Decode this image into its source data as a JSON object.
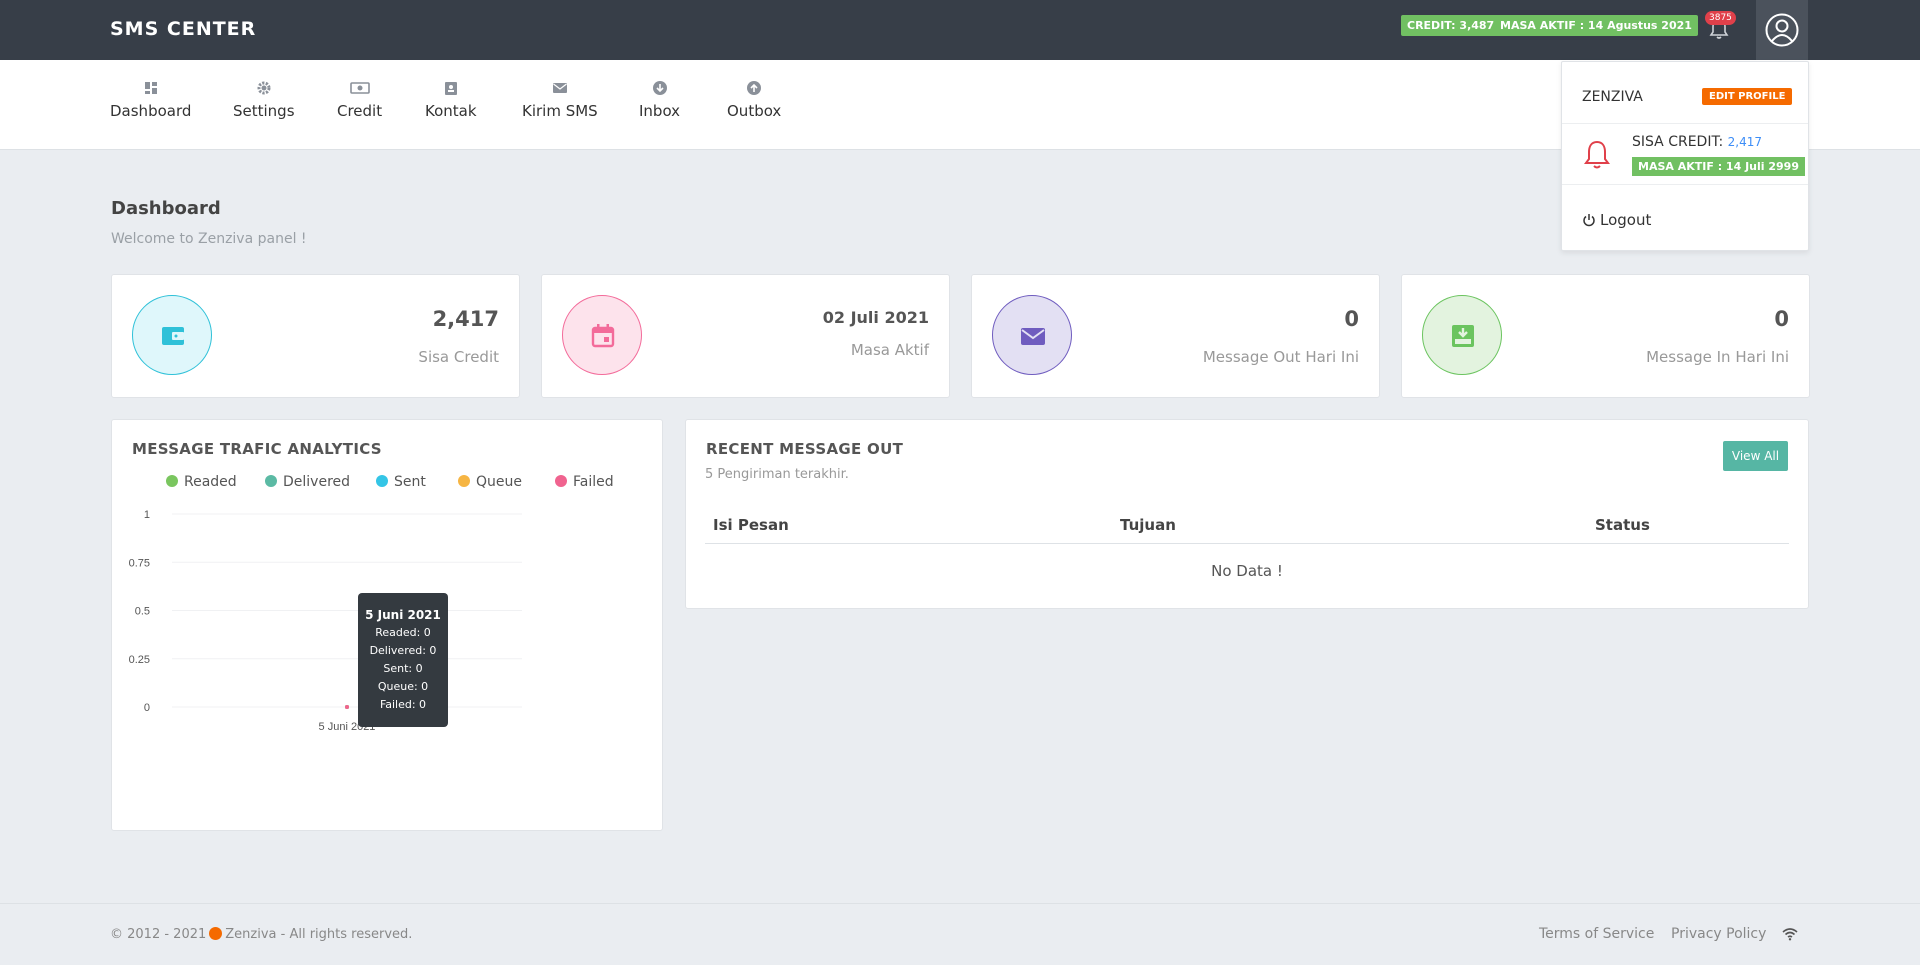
{
  "header": {
    "brand": "SMS CENTER",
    "credit_pill": "CREDIT: 3,487",
    "masa_pill": "MASA AKTIF : 14 Agustus 2021",
    "notif_count": "3875"
  },
  "nav": {
    "items": [
      {
        "label": "Dashboard",
        "icon": "dashboard-icon"
      },
      {
        "label": "Settings",
        "icon": "gear-icon"
      },
      {
        "label": "Credit",
        "icon": "money-icon"
      },
      {
        "label": "Kontak",
        "icon": "contact-icon"
      },
      {
        "label": "Kirim SMS",
        "icon": "envelope-icon"
      },
      {
        "label": "Inbox",
        "icon": "arrow-down-icon"
      },
      {
        "label": "Outbox",
        "icon": "arrow-up-icon"
      }
    ]
  },
  "page": {
    "title": "Dashboard",
    "subtitle": "Welcome to Zenziva panel !"
  },
  "stats": [
    {
      "value": "2,417",
      "label": "Sisa Credit",
      "color": "#2fc1d8",
      "icon": "wallet-icon"
    },
    {
      "value": "02 Juli 2021",
      "label": "Masa Aktif",
      "color": "#f36b9a",
      "icon": "calendar-icon"
    },
    {
      "value": "0",
      "label": "Message Out Hari Ini",
      "color": "#6f5cbf",
      "icon": "mail-icon"
    },
    {
      "value": "0",
      "label": "Message In Hari Ini",
      "color": "#6bc45f",
      "icon": "inbox-tray-icon"
    }
  ],
  "analytics": {
    "title": "MESSAGE TRAFIC ANALYTICS",
    "tooltip": {
      "title": "5 Juni 2021",
      "lines": [
        "Readed: 0",
        "Delivered: 0",
        "Sent: 0",
        "Queue: 0",
        "Failed: 0"
      ]
    }
  },
  "chart_data": {
    "type": "line",
    "x": [
      "5 Juni 2021"
    ],
    "series": [
      {
        "name": "Readed",
        "values": [
          0
        ],
        "color": "#7ac65f"
      },
      {
        "name": "Delivered",
        "values": [
          0
        ],
        "color": "#5bbaa4"
      },
      {
        "name": "Sent",
        "values": [
          0
        ],
        "color": "#34c5e6"
      },
      {
        "name": "Queue",
        "values": [
          0
        ],
        "color": "#f6b543"
      },
      {
        "name": "Failed",
        "values": [
          0
        ],
        "color": "#f0638f"
      }
    ],
    "y_ticks": [
      "1",
      "0.75",
      "0.5",
      "0.25",
      "0"
    ],
    "ylim": [
      0,
      1
    ],
    "grid": true,
    "legend": "top"
  },
  "recent": {
    "title": "RECENT MESSAGE OUT",
    "subtitle": "5 Pengiriman terakhir.",
    "view_all": "View All",
    "columns": [
      "Isi Pesan",
      "Tujuan",
      "Status"
    ],
    "empty": "No Data !"
  },
  "dropdown": {
    "name": "ZENZIVA",
    "edit": "EDIT PROFILE",
    "credit_label": "SISA CREDIT:",
    "credit_value": "2,417",
    "masa": "MASA AKTIF : 14 Juli 2999",
    "logout": "Logout"
  },
  "footer": {
    "copyright": "© 2012 - 2021",
    "company": "Zenziva - All rights reserved.",
    "terms": "Terms of Service",
    "privacy": "Privacy Policy"
  }
}
